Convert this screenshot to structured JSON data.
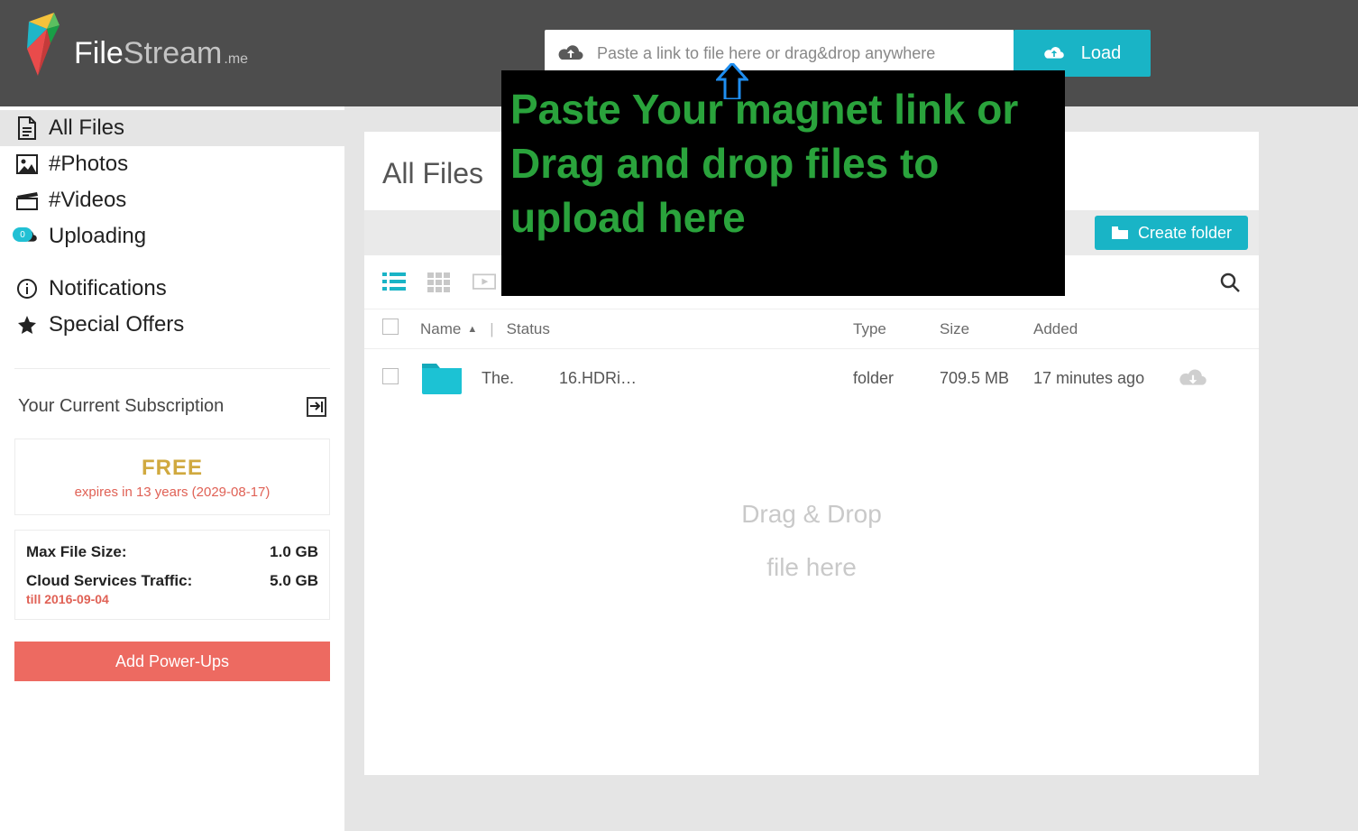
{
  "brand": {
    "name_a": "File",
    "name_b": "Stream",
    "suffix": ".me"
  },
  "header": {
    "link_placeholder": "Paste a link to file here or drag&drop anywhere",
    "load_label": "Load"
  },
  "overlay": {
    "text": "Paste Your magnet link or Drag and drop files to upload here"
  },
  "sidebar": {
    "items": [
      {
        "label": "All Files"
      },
      {
        "label": "#Photos"
      },
      {
        "label": "#Videos"
      },
      {
        "label": "Uploading",
        "badge": "0"
      },
      {
        "label": "Notifications"
      },
      {
        "label": "Special Offers"
      }
    ],
    "subscription_title": "Your Current Subscription",
    "plan": {
      "name": "FREE",
      "expires": "expires in 13 years (2029-08-17)"
    },
    "limits": {
      "max_file_label": "Max File Size:",
      "max_file_value": "1.0 GB",
      "traffic_label": "Cloud Services Traffic:",
      "traffic_value": "5.0 GB",
      "traffic_till": "till 2016-09-04"
    },
    "powerups_label": "Add Power-Ups"
  },
  "main": {
    "title": "All Files",
    "create_folder_label": "Create folder",
    "columns": {
      "name": "Name",
      "status": "Status",
      "type": "Type",
      "size": "Size",
      "added": "Added"
    },
    "rows": [
      {
        "name": "The.          16.HDRi…",
        "type": "folder",
        "size": "709.5 MB",
        "added": "17 minutes ago"
      }
    ],
    "dropzone": {
      "line1": "Drag & Drop",
      "line2": "file here"
    }
  },
  "colors": {
    "accent": "#19b4c6",
    "danger": "#ed6a61",
    "gold": "#d0a93f"
  }
}
